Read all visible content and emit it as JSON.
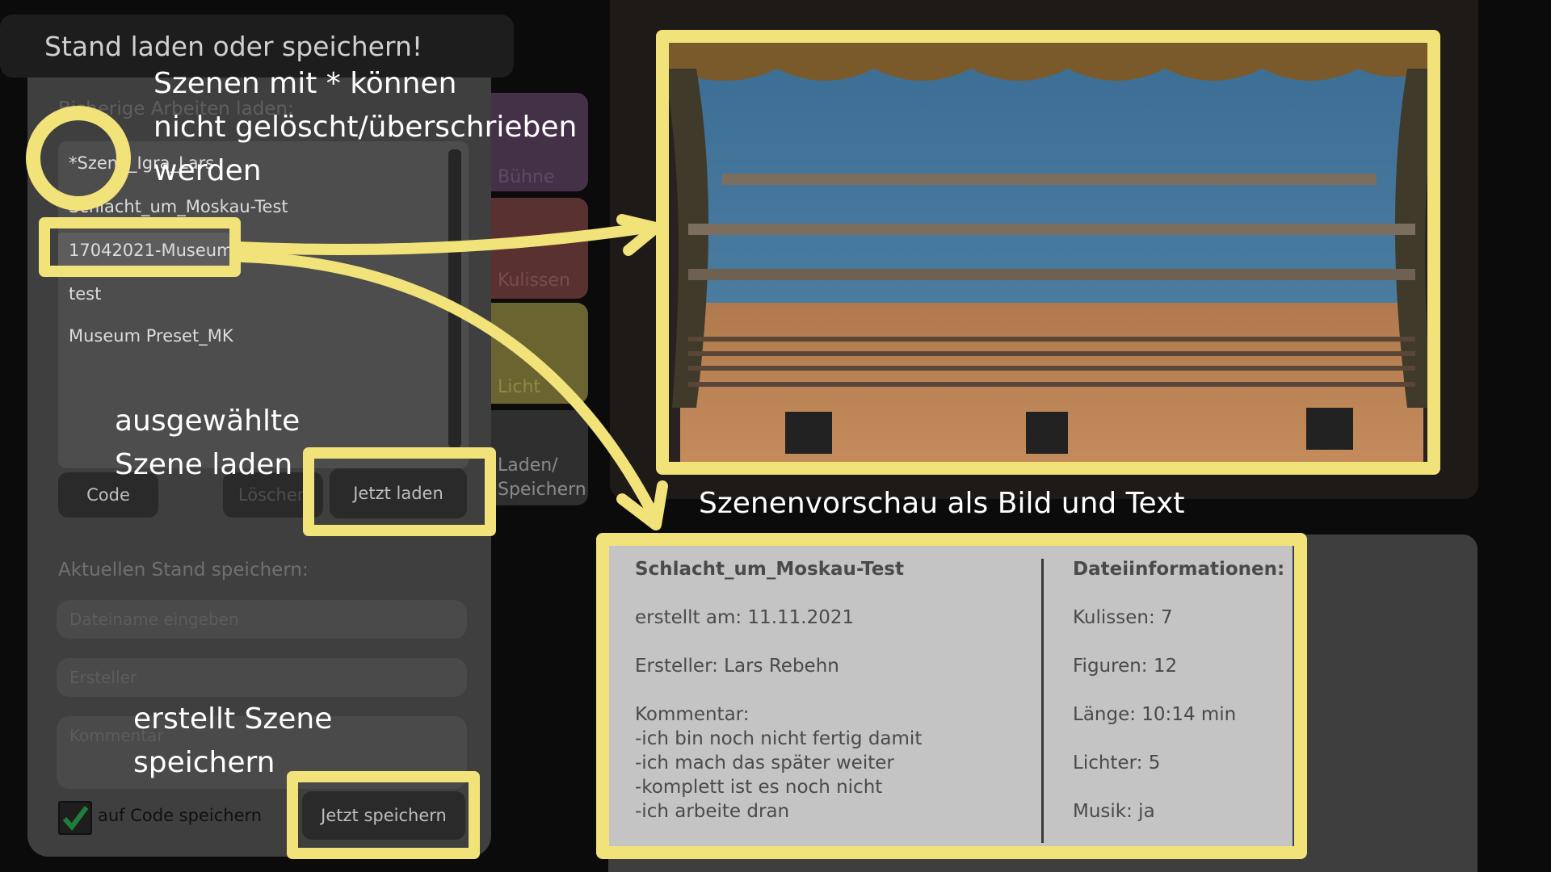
{
  "dialog": {
    "title": "Stand laden oder speichern!",
    "load_section_label": "Bisherige Arbeiten laden:",
    "save_section_label": "Aktuellen Stand speichern:",
    "scenes": [
      "*Szene_Igra_Lars",
      "Schlacht_um_Moskau-Test",
      "17042021-Museum",
      "test",
      "Museum Preset_MK"
    ],
    "buttons": {
      "code": "Code",
      "delete": "Löschen",
      "load": "Jetzt laden",
      "save": "Jetzt speichern"
    },
    "inputs": {
      "filename_placeholder": "Dateiname eingeben",
      "creator_placeholder": "Ersteller",
      "comment_placeholder": "Kommentar"
    },
    "checkbox": {
      "label": "auf Code speichern",
      "checked": true
    }
  },
  "tabs": [
    "Bühne",
    "Kulissen",
    "Licht",
    "Laden/",
    "Speichern"
  ],
  "info": {
    "scene_name": "Schlacht_um_Moskau-Test",
    "created": "erstellt am: 11.11.2021",
    "creator": "Ersteller: Lars Rebehn",
    "comment_label": "Kommentar:",
    "comment_lines": [
      "-ich bin noch nicht fertig damit",
      "-ich mach das später weiter",
      "-komplett ist es noch nicht",
      "-ich arbeite dran"
    ],
    "file_info_title": "Dateiinformationen:",
    "kulissen": "Kulissen: 7",
    "figuren": "Figuren: 12",
    "laenge": "Länge: 10:14 min",
    "lichter": "Lichter: 5",
    "musik": "Musik: ja"
  },
  "annotations": {
    "a1": [
      "Szenen mit * können",
      "nicht gelöscht/überschrieben",
      "werden"
    ],
    "a2": [
      "ausgewählte",
      "Szene laden"
    ],
    "a3": "Szenenvorschau als Bild und Text",
    "a4": [
      "erstellt Szene",
      "speichern"
    ]
  },
  "colors": {
    "highlight": "#f2e27a",
    "tab_buehne": "#443148",
    "tab_kulissen": "#5a3131",
    "tab_licht": "#6a6530",
    "tab_laden": "#2f2f2f"
  }
}
